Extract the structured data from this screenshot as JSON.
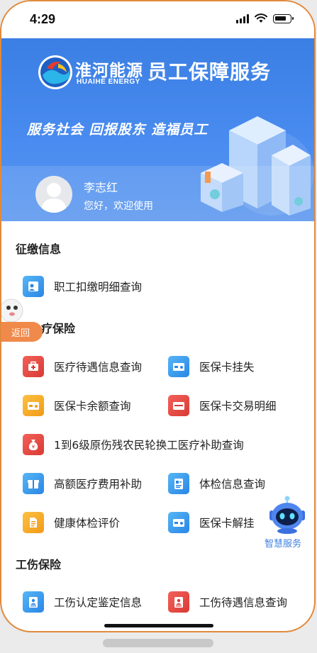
{
  "status_bar": {
    "time": "4:29"
  },
  "banner": {
    "brand_cn": "淮河能源",
    "brand_en": "HUAIHE ENERGY",
    "title": "员工保障服务",
    "slogan": "服务社会  回报股东  造福员工"
  },
  "user": {
    "name": "李志红",
    "greeting": "您好，欢迎使用"
  },
  "sections": {
    "collection": {
      "title": "征缴信息",
      "items": [
        {
          "label": "职工扣缴明细查询",
          "icon": "person-card-icon",
          "color": "#2a86e6"
        }
      ]
    },
    "medical": {
      "title": "医疗保险",
      "title_visible": "疗保险",
      "items": [
        {
          "label": "医疗待遇信息查询",
          "icon": "medical-kit-icon",
          "color": "#d93a34"
        },
        {
          "label": "医保卡挂失",
          "icon": "card-icon",
          "color": "#2a86e6"
        },
        {
          "label": "医保卡余额查询",
          "icon": "card-icon",
          "color": "#f29a18"
        },
        {
          "label": "医保卡交易明细",
          "icon": "card-icon",
          "color": "#d93a34"
        },
        {
          "label": "1到6级原伤残农民轮换工医疗补助查询",
          "icon": "money-bag-icon",
          "color": "#d93a34"
        },
        {
          "label": "高额医疗费用补助",
          "icon": "gift-icon",
          "color": "#2a86e6"
        },
        {
          "label": "体检信息查询",
          "icon": "report-icon",
          "color": "#2a86e6"
        },
        {
          "label": "健康体检评价",
          "icon": "document-icon",
          "color": "#f29a18"
        },
        {
          "label": "医保卡解挂",
          "icon": "card-icon",
          "color": "#2a86e6"
        }
      ]
    },
    "injury": {
      "title": "工伤保险",
      "items": [
        {
          "label": "工伤认定鉴定信息",
          "icon": "id-document-icon",
          "color": "#2a86e6"
        },
        {
          "label": "工伤待遇信息查询",
          "icon": "id-document-icon",
          "color": "#d93a34"
        }
      ]
    }
  },
  "floating": {
    "back_label": "返回",
    "assistant_label": "智慧服务"
  }
}
